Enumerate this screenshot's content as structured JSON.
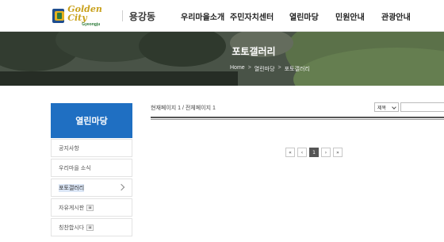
{
  "header": {
    "logo_main": "Golden City",
    "logo_sub": "Gyeongju",
    "dong_name": "용강동",
    "nav": [
      "우리마을소개",
      "주민자치센터",
      "열린마당",
      "민원안내",
      "관광안내"
    ]
  },
  "banner": {
    "title": "포토갤러리",
    "breadcrumb": [
      "Home",
      "열린마당",
      "포토갤러리"
    ],
    "breadcrumb_sep": ">"
  },
  "sidebar": {
    "title": "열린마당",
    "items": [
      {
        "label": "공지사항",
        "badge": ""
      },
      {
        "label": "우리마을 소식",
        "badge": ""
      },
      {
        "label": "포토갤러리",
        "badge": "",
        "active": true
      },
      {
        "label": "자유게시판",
        "badge": "▣"
      },
      {
        "label": "칭찬합시다",
        "badge": "▣"
      }
    ]
  },
  "content": {
    "page_info": "현재페이지 1 / 전체페이지 1",
    "search_select": "제목",
    "search_placeholder": ""
  },
  "pagination": {
    "first": "«",
    "prev": "‹",
    "current": "1",
    "next": "›",
    "last": "»"
  }
}
